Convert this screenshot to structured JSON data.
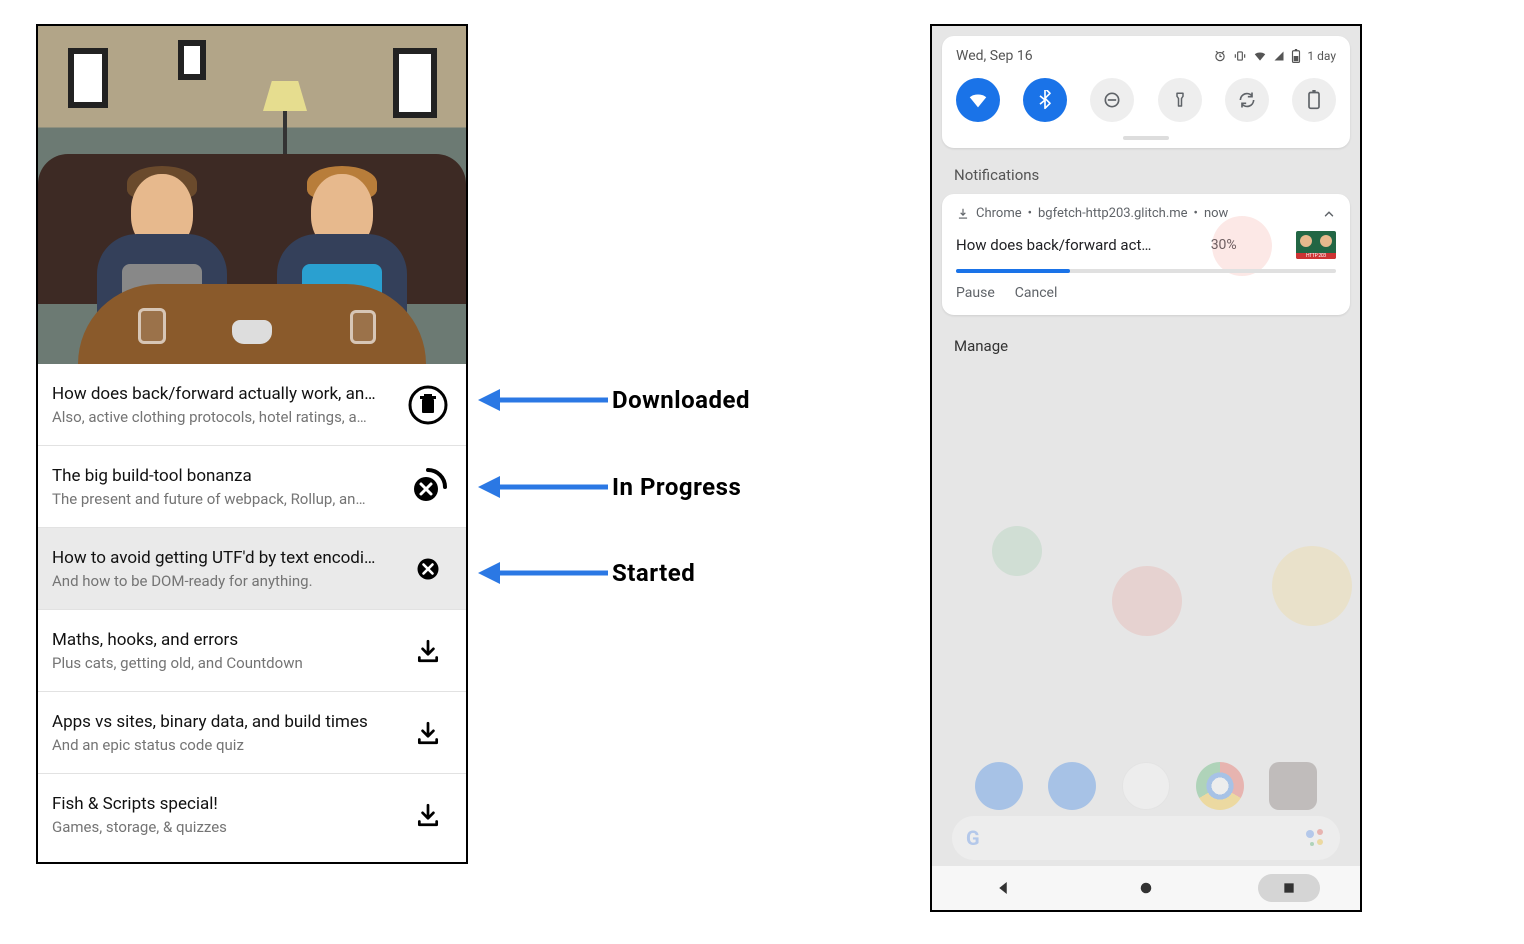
{
  "app": {
    "items": [
      {
        "title": "How does back/forward actually work, an…",
        "subtitle": "Also, active clothing protocols, hotel ratings, a…",
        "state": "downloaded"
      },
      {
        "title": "The big build-tool bonanza",
        "subtitle": "The present and future of webpack, Rollup, an…",
        "state": "progress"
      },
      {
        "title": "How to avoid getting UTF'd by text encodi…",
        "subtitle": "And how to be DOM-ready for anything.",
        "state": "started"
      },
      {
        "title": "Maths, hooks, and errors",
        "subtitle": "Plus cats, getting old, and Countdown",
        "state": "idle"
      },
      {
        "title": "Apps vs sites, binary data, and build times",
        "subtitle": "And an epic status code quiz",
        "state": "idle"
      },
      {
        "title": "Fish & Scripts special!",
        "subtitle": "Games, storage, & quizzes",
        "state": "idle"
      }
    ]
  },
  "annotations": {
    "downloaded": "Downloaded",
    "in_progress": "In Progress",
    "started": "Started"
  },
  "phone": {
    "date": "Wed, Sep 16",
    "battery_text": "1 day",
    "notifications_label": "Notifications",
    "manage_label": "Manage",
    "notif": {
      "app": "Chrome",
      "source": "bgfetch-http203.glitch.me",
      "when": "now",
      "title": "How does back/forward act…",
      "percent_text": "30%",
      "percent": 30,
      "pause": "Pause",
      "cancel": "Cancel"
    }
  }
}
